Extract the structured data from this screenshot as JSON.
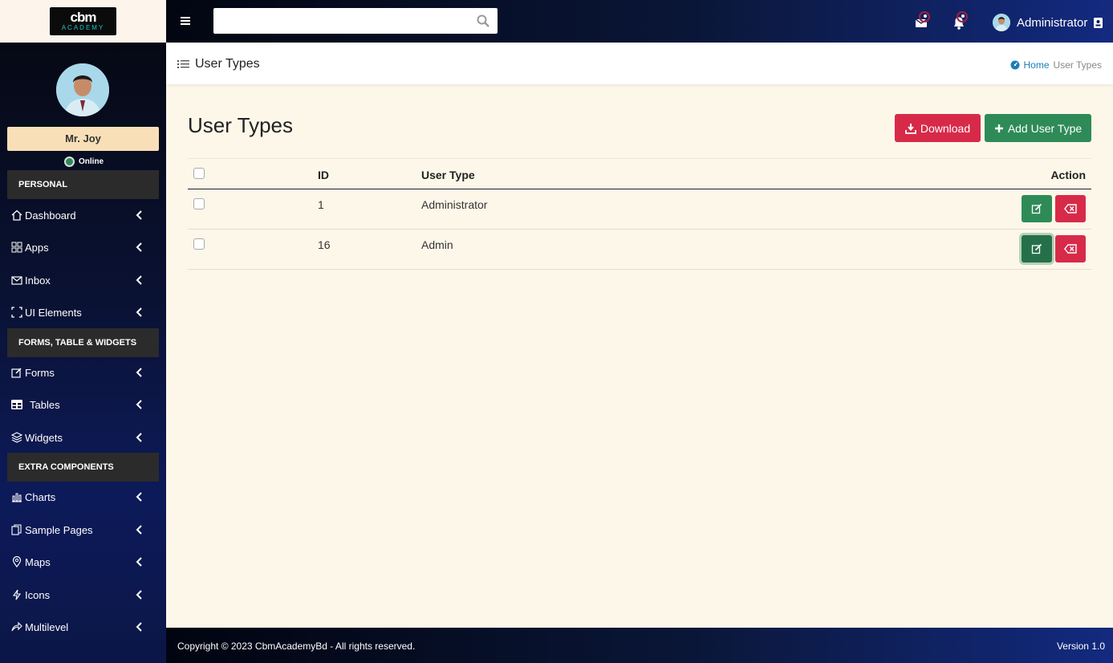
{
  "brand": {
    "logo_main": "cbm",
    "logo_sub": "ACADEMY"
  },
  "sidebar": {
    "user_name": "Mr. Joy",
    "status": "Online",
    "sections": [
      "PERSONAL",
      "FORMS, TABLE & WIDGETS",
      "EXTRA COMPONENTS"
    ],
    "items": [
      {
        "label": "Dashboard",
        "icon": "home-icon"
      },
      {
        "label": "Apps",
        "icon": "grid-icon"
      },
      {
        "label": "Inbox",
        "icon": "envelope-icon"
      },
      {
        "label": "UI Elements",
        "icon": "frame-icon"
      },
      {
        "label": "Forms",
        "icon": "edit-icon"
      },
      {
        "label": "Tables",
        "icon": "table-icon"
      },
      {
        "label": "Widgets",
        "icon": "layers-icon"
      },
      {
        "label": "Charts",
        "icon": "bar-chart-icon"
      },
      {
        "label": "Sample Pages",
        "icon": "copy-icon"
      },
      {
        "label": "Maps",
        "icon": "map-pin-icon"
      },
      {
        "label": "Icons",
        "icon": "lightning-icon"
      },
      {
        "label": "Multilevel",
        "icon": "share-icon"
      }
    ]
  },
  "topbar": {
    "search_value": "",
    "user_label": "Administrator"
  },
  "breadcrumb": {
    "title": "User Types",
    "home": "Home",
    "current": "User Types"
  },
  "main": {
    "heading": "User Types",
    "download_label": "Download",
    "add_label": "Add User Type",
    "columns": {
      "id": "ID",
      "user_type": "User Type",
      "action": "Action"
    },
    "rows": [
      {
        "id": "1",
        "user_type": "Administrator"
      },
      {
        "id": "16",
        "user_type": "Admin"
      }
    ]
  },
  "footer": {
    "copyright": "Copyright © 2023 CbmAcademyBd - All rights reserved.",
    "version": "Version 1.0"
  },
  "colors": {
    "accent_red": "#d72a49",
    "accent_green": "#2e8b57",
    "page_bg": "#fdf7ea",
    "link_blue": "#1c7db6"
  }
}
